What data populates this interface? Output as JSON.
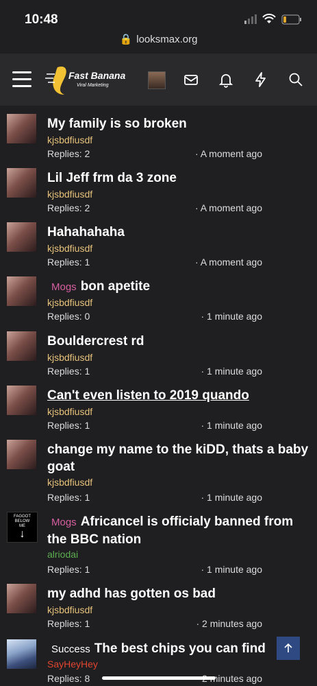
{
  "status": {
    "time": "10:48"
  },
  "browser": {
    "url": "looksmax.org"
  },
  "header": {
    "logo_main": "Fast Banana",
    "logo_sub": "Viral Marketing"
  },
  "threads": [
    {
      "title": "My family is so broken",
      "prefix": "",
      "author": "kjsbdfiusdf",
      "replies": "Replies: 2",
      "time": "· A moment ago",
      "thumb": "girl"
    },
    {
      "title": "Lil Jeff frm da 3 zone",
      "prefix": "",
      "author": "kjsbdfiusdf",
      "replies": "Replies: 2",
      "time": "· A moment ago",
      "thumb": "girl"
    },
    {
      "title": "Hahahahaha",
      "prefix": "",
      "author": "kjsbdfiusdf",
      "replies": "Replies: 1",
      "time": "· A moment ago",
      "thumb": "girl"
    },
    {
      "title": "bon apetite",
      "prefix": "Mogs",
      "author": "kjsbdfiusdf",
      "replies": "Replies: 0",
      "time": "· 1 minute ago",
      "thumb": "girl"
    },
    {
      "title": "Bouldercrest rd",
      "prefix": "",
      "author": "kjsbdfiusdf",
      "replies": "Replies: 1",
      "time": "· 1 minute ago",
      "thumb": "girl"
    },
    {
      "title": "Can't even listen to 2019 quando",
      "prefix": "",
      "author": "kjsbdfiusdf",
      "replies": "Replies: 1",
      "time": "· 1 minute ago",
      "thumb": "girl"
    },
    {
      "title": "change my name to the kiDD, thats a baby goat",
      "prefix": "",
      "author": "kjsbdfiusdf",
      "replies": "Replies: 1",
      "time": "· 1 minute ago",
      "thumb": "girl"
    },
    {
      "title": "Africancel is officialy banned from the BBC nation",
      "prefix": "Mogs",
      "author": "alriodai",
      "replies": "Replies: 1",
      "time": "· 1 minute ago",
      "thumb": "sign",
      "thumb_text": "FAGGOT BELOW ME"
    },
    {
      "title": "my adhd has gotten os bad",
      "prefix": "",
      "author": "kjsbdfiusdf",
      "replies": "Replies: 1",
      "time": "· 2 minutes ago",
      "thumb": "girl"
    },
    {
      "title": "The best chips you can find",
      "prefix": "Success",
      "author": "SayHeyHey",
      "replies": "Replies: 8",
      "time": "· 2 minutes ago",
      "thumb": "anime"
    }
  ],
  "colors": {
    "background": "#1f1f21",
    "header": "#2a2a2c",
    "author": "#e7c27a",
    "mogs": "#d65fa0",
    "success": "#ffffff",
    "green_author": "#5cae4f",
    "red_author": "#e0452f",
    "scroll_button": "#2f4a82"
  }
}
